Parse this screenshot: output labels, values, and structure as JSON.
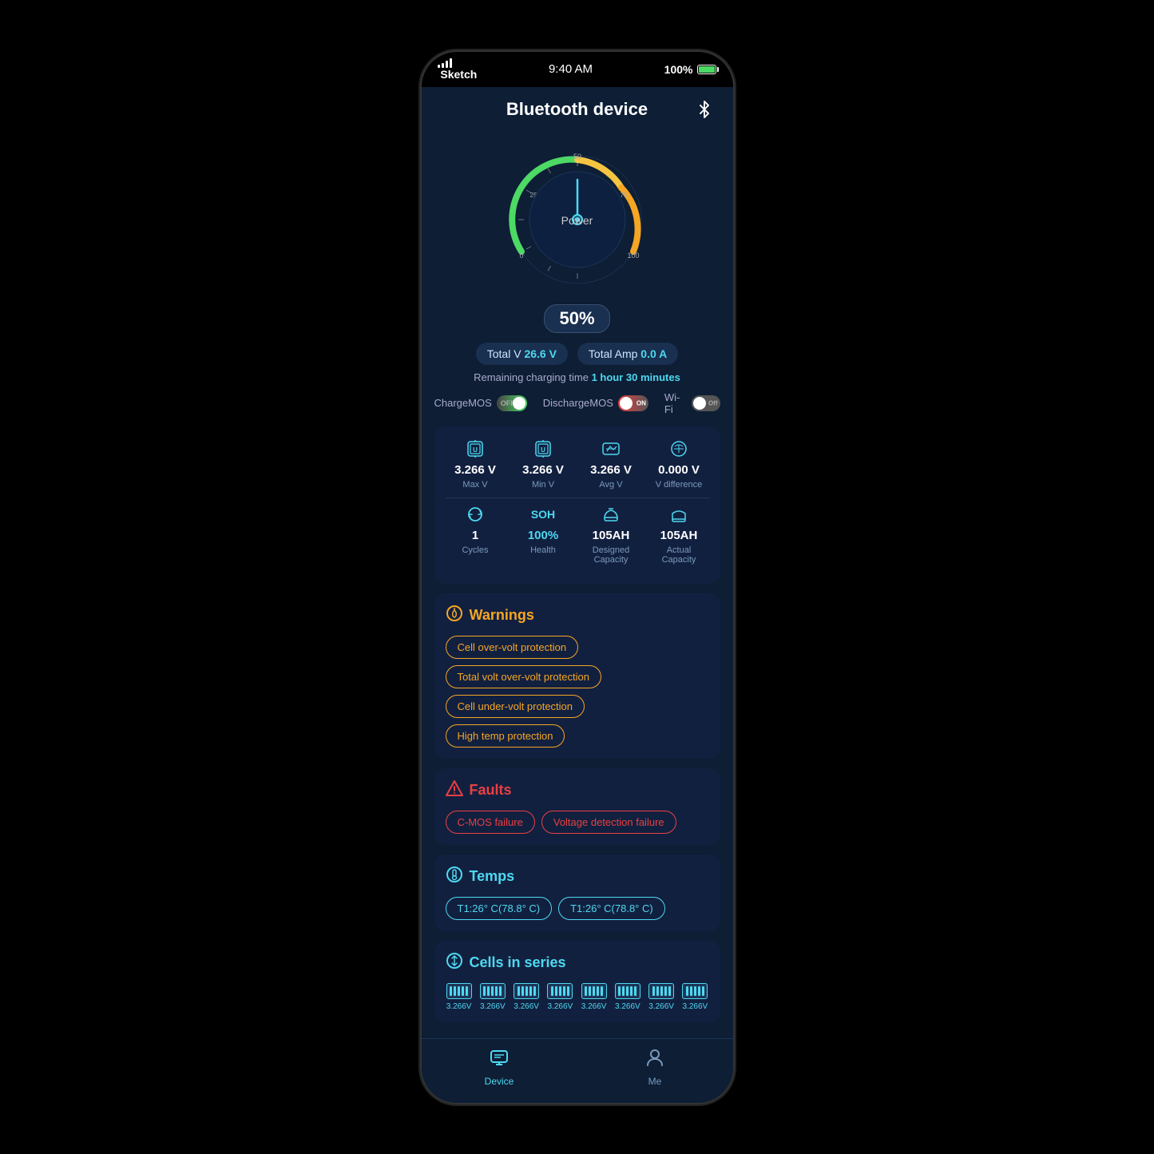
{
  "status_bar": {
    "signal": "Sketch",
    "time": "9:40 AM",
    "battery": "100%"
  },
  "header": {
    "title": "Bluetooth device",
    "bt_icon": "bluetooth"
  },
  "gauge": {
    "percent": "50%",
    "label": "Power",
    "needle_angle": 0
  },
  "stats": {
    "total_v_label": "Total V",
    "total_v_value": "26.6 V",
    "total_amp_label": "Total Amp",
    "total_amp_value": "0.0 A",
    "charging_time_label": "Remaining charging time",
    "charging_time_value": "1 hour 30 minutes"
  },
  "mos": {
    "charge_label": "ChargeMOS",
    "charge_state": "OFF",
    "discharge_label": "DischargeMOS",
    "discharge_state": "ON",
    "wifi_label": "Wi-Fi",
    "wifi_state": "Off"
  },
  "metrics": {
    "max_v": "3.266 V",
    "min_v": "3.266 V",
    "avg_v": "3.266 V",
    "v_diff": "0.000 V",
    "max_v_label": "Max V",
    "min_v_label": "Min V",
    "avg_v_label": "Avg V",
    "v_diff_label": "V difference",
    "cycles": "1",
    "cycles_label": "Cycles",
    "health": "100%",
    "health_label": "Health",
    "designed_cap": "105AH",
    "designed_cap_label": "Designed Capacity",
    "actual_cap": "105AH",
    "actual_cap_label": "Actual Capacity"
  },
  "warnings": {
    "section_title": "Warnings",
    "items": [
      "Cell over-volt protection",
      "Total volt over-volt protection",
      "Cell under-volt protection",
      "High temp protection"
    ]
  },
  "faults": {
    "section_title": "Faults",
    "items": [
      "C-MOS failure",
      "Voltage detection failure"
    ]
  },
  "temps": {
    "section_title": "Temps",
    "items": [
      "T1:26° C(78.8° C)",
      "T1:26° C(78.8° C)"
    ]
  },
  "cells": {
    "section_title": "Cells in series",
    "items": [
      "3.266V",
      "3.266V",
      "3.266V",
      "3.266V",
      "3.266V",
      "3.266V",
      "3.266V",
      "3.266V"
    ]
  },
  "bottom_nav": {
    "device_label": "Device",
    "me_label": "Me"
  }
}
